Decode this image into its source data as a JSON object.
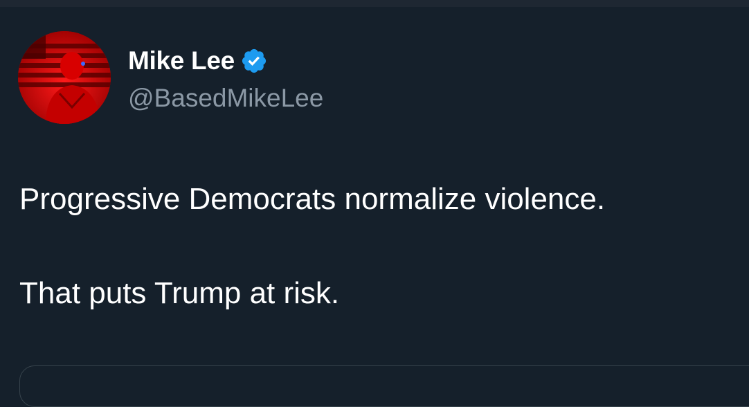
{
  "user": {
    "display_name": "Mike Lee",
    "handle": "@BasedMikeLee",
    "verified": true,
    "verified_badge_color": "#1d9bf0",
    "avatar_icon": "profile-photo-red-tinted"
  },
  "tweet": {
    "paragraphs": [
      "Progressive Democrats normalize violence.",
      "That puts Trump at risk."
    ]
  },
  "colors": {
    "background": "#15202b",
    "text_primary": "#ffffff",
    "text_secondary": "#8b98a5",
    "avatar_tint": "#e00000"
  }
}
